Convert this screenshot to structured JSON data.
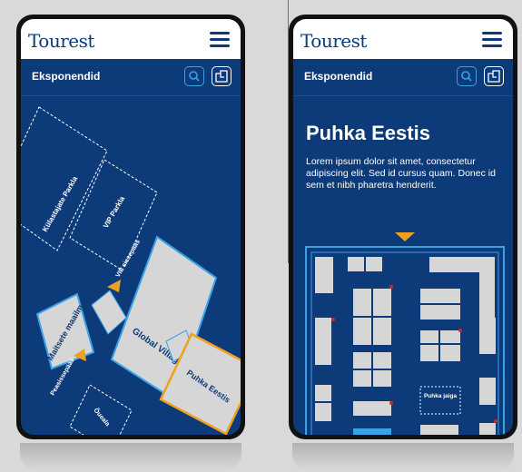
{
  "screens": [
    {
      "logo": "Tourest",
      "subtitle": "Eksponendid",
      "map_labels": {
        "kulastajate_parkla": "Külastajate Parkla",
        "vip_parkla": "VIP Parkla",
        "vip_sissepaas": "VIP sissepääs",
        "global_village": "Global Village",
        "maitsete_maailm": "Maitsete maailm",
        "peasissepaas": "Peasissepääs",
        "ounaala": "Õueala",
        "puhka_eestis": "Puhka Eestis"
      }
    },
    {
      "logo": "Tourest",
      "subtitle": "Eksponendid",
      "heading": "Puhka Eestis",
      "description": "Lorem ipsum dolor sit amet, consectetur adipiscing elit. Sed id cursus quam. Donec id sem et nibh pharetra hendrerit.",
      "booth_label": "Puhka jaiga"
    }
  ],
  "colors": {
    "background": "#0d3a78",
    "accent": "#f0a020",
    "highlight": "#3aa3e8",
    "hall": "#d6d6d6"
  },
  "icons": [
    "hamburger-menu-icon",
    "search-icon",
    "map-icon"
  ]
}
